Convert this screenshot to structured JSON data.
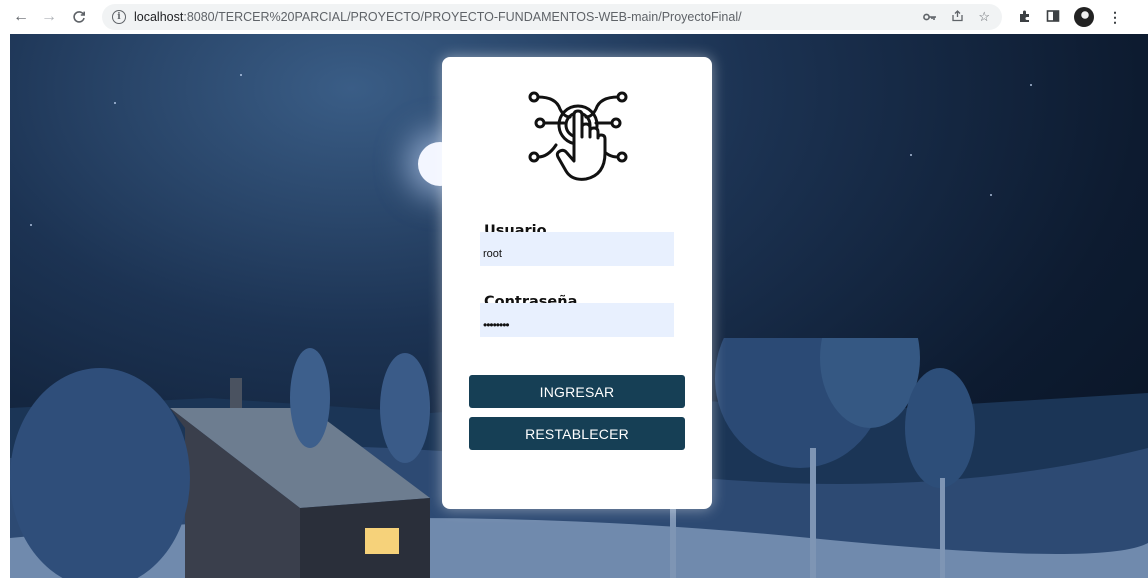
{
  "browser": {
    "url_host": "localhost",
    "url_path": ":8080/TERCER%20PARCIAL/PROYECTO/PROYECTO-FUNDAMENTOS-WEB-main/ProyectoFinal/",
    "icons": [
      "back-arrow-icon",
      "forward-arrow-icon",
      "reload-icon",
      "info-icon",
      "key-icon",
      "share-icon",
      "star-icon",
      "extensions-icon",
      "sidepanel-icon",
      "profile-avatar",
      "menu-icon"
    ]
  },
  "login": {
    "logo": "touch-circuit-icon",
    "user_label": "Usuario",
    "user_value": "root",
    "password_label": "Contraseña",
    "password_value": "12345678",
    "submit_label": "INGRESAR",
    "reset_label": "RESTABLECER"
  },
  "colors": {
    "button_bg": "#163f55",
    "input_bg": "#e8f0fe",
    "card_bg": "#ffffff"
  }
}
